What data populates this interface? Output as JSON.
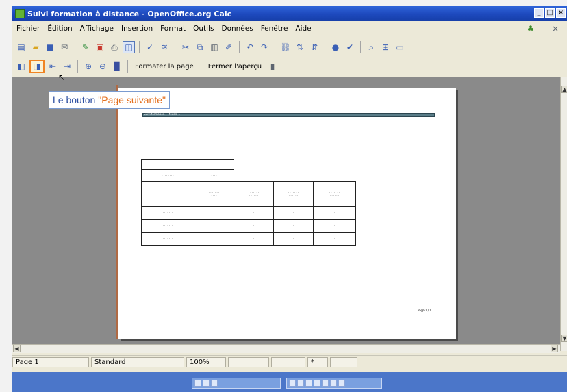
{
  "window": {
    "title": "Suivi formation à distance - OpenOffice.org Calc",
    "controls": [
      "_",
      "□",
      "×"
    ]
  },
  "menubar": {
    "items": [
      "Fichier",
      "Édition",
      "Affichage",
      "Insertion",
      "Format",
      "Outils",
      "Données",
      "Fenêtre",
      "Aide"
    ]
  },
  "preview_toolbar": {
    "format_page_label": "Formater la page",
    "close_preview_label": "Fermer l'aperçu"
  },
  "tooltip": {
    "prefix": "Le bouton",
    "highlight": "\"Page suivante\""
  },
  "preview": {
    "header_label": "Suivi formation — feuille 1",
    "footer_text": "Page 1 / 1"
  },
  "statusbar": {
    "page": "Page 1",
    "style": "Standard",
    "zoom": "100%"
  },
  "icons": {
    "toolbar1": [
      "new-icon",
      "open-icon",
      "save-icon",
      "mail-icon",
      "edit-file-icon",
      "pdf-icon",
      "print-icon",
      "preview-icon",
      "spellcheck-icon",
      "autospell-icon",
      "cut-icon",
      "copy-icon",
      "paste-icon",
      "format-paintbrush-icon",
      "undo-icon",
      "redo-icon",
      "hyperlink-icon",
      "sort-ascending-icon",
      "sort-descending-icon",
      "chart-icon",
      "navigator-icon",
      "find-icon",
      "gallery-icon",
      "datasource-icon"
    ],
    "toolbar2": [
      "previous-page-icon",
      "next-page-icon",
      "first-page-icon",
      "last-page-icon",
      "zoom-in-icon",
      "zoom-out-icon",
      "fullscreen-icon"
    ]
  },
  "colors": {
    "tooltip_prefix": "#2d4fa1",
    "tooltip_highlight": "#e4701f",
    "titlebar": "#1d49bd"
  }
}
